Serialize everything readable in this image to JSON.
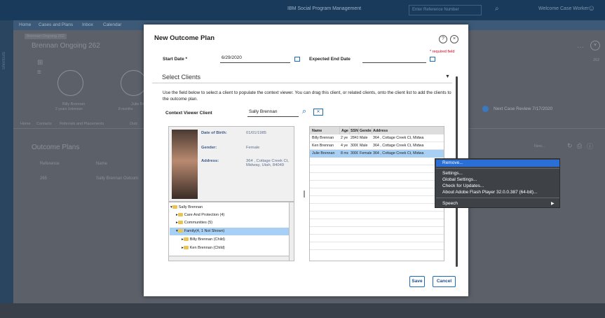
{
  "topbar": {
    "title": "IBM Social Program Management",
    "ref_placeholder": "Enter Reference Number",
    "welcome": "Welcome Case Worker"
  },
  "sidebar": {
    "shortcuts": "Shortcuts"
  },
  "main_tabs": [
    "Home",
    "Cases and Plans",
    "Inbox",
    "Calendar"
  ],
  "bg": {
    "subtab": "Brennan Ongoing 262",
    "case_title": "Brennan Ongoing 262",
    "person1_name": "Billy Brennan",
    "person1_meta": "2 years   Unknown",
    "person2_name": "Julie Bre",
    "person2_meta": "8 months",
    "nav_tabs": [
      "Home",
      "Contacts",
      "Referrals and Placements",
      "Outc"
    ],
    "section": "Outcome Plans",
    "col_reference": "Reference",
    "col_name": "Name",
    "row_ref": "265",
    "row_name": "Sally Brennan Outcom",
    "next_review": "Next Case Review  7/17/2020",
    "right_num": "262",
    "new_btn": "New..."
  },
  "dialog": {
    "title": "New Outcome Plan",
    "help": "?",
    "close": "×",
    "start_label": "Start Date *",
    "start_value": "6/29/2020",
    "end_label": "Expected End Date",
    "required_note": "* required field",
    "section_title": "Select Clients",
    "description": "Use the field below to select a client to populate the context viewer. You can drag this client, or related clients, onto the client list to add the clients to the outcome plan.",
    "context_label": "Context Viewer Client",
    "context_value": "Sally Brennan",
    "save": "Save",
    "cancel": "Cancel"
  },
  "person_card": {
    "dob_label": "Date of Birth:",
    "dob": "01/01/1985",
    "gender_label": "Gender:",
    "gender": "Female",
    "address_label": "Address:",
    "address": "364 , Cottage Creek Ct,\nMidway, Utah, 84049"
  },
  "tree": [
    "Sally Brennan",
    "Care And Protection (4)",
    "Communities (5)",
    "Family(4, 1 Not Shown)",
    "Billy Brennan (Child)",
    "Ken Brennan (Child)"
  ],
  "clients": {
    "headers": [
      "Name",
      "Age",
      "SSN",
      "Gender",
      "Address"
    ],
    "rows": [
      [
        "Billy Brennan",
        "2 ye",
        "2841",
        "Male",
        "364 , Cottage Creek Ct, Midwa"
      ],
      [
        "Ken Brennan",
        "4 ye",
        "300C",
        "Male",
        "364 , Cottage Creek Ct, Midwa"
      ],
      [
        "Julie Brennan",
        "8 mc",
        "300C",
        "Female",
        "364 , Cottage Creek Ct, Midwa"
      ]
    ]
  },
  "context_menu": {
    "items": [
      "Remove...",
      "Settings...",
      "Global Settings...",
      "Check for Updates...",
      "About Adobe Flash Player 32.0.0.387 (64-bit)...",
      "Speech"
    ],
    "submenu_arrow": "▶"
  },
  "colors": {
    "accent": "#1a6bb8",
    "menu_highlight": "#2a6fd6"
  }
}
